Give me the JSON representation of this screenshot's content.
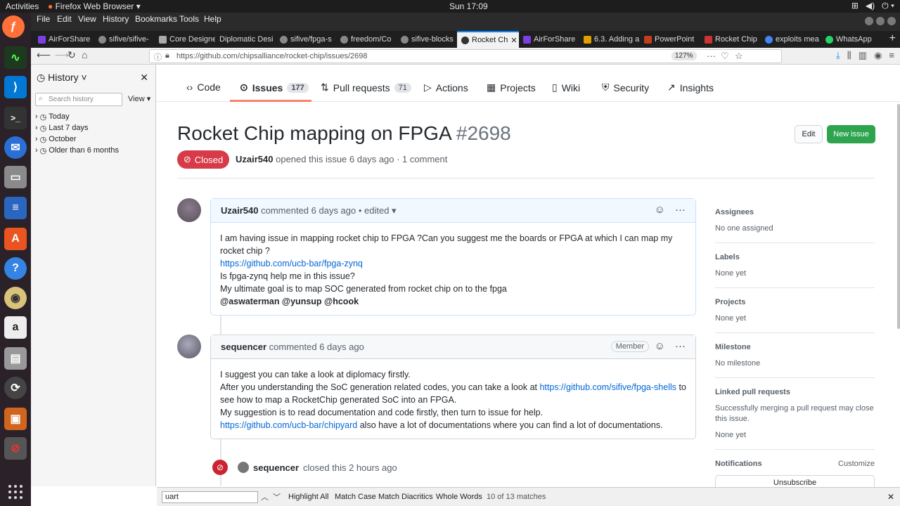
{
  "system": {
    "activities": "Activities",
    "app_menu": "Firefox Web Browser ▾",
    "clock": "Sun 17:09"
  },
  "menubar": [
    "File",
    "Edit",
    "View",
    "History",
    "Bookmarks",
    "Tools",
    "Help"
  ],
  "tabs": [
    {
      "label": "AirForShare",
      "color": "#7b3fe4"
    },
    {
      "label": "sifive/sifive-",
      "color": "#888888"
    },
    {
      "label": "Core Designe",
      "color": "#aaaaaa"
    },
    {
      "label": "Diplomatic Desi",
      "color": "#555555"
    },
    {
      "label": "sifive/fpga-s",
      "color": "#888888"
    },
    {
      "label": "freedom/Co",
      "color": "#888888"
    },
    {
      "label": "sifive-blocks",
      "color": "#888888"
    },
    {
      "label": "Rocket Ch",
      "color": "#333333",
      "active": true
    },
    {
      "label": "AirForShare",
      "color": "#7b3fe4"
    },
    {
      "label": "6.3. Adding a",
      "color": "#e0a000"
    },
    {
      "label": "PowerPoint",
      "color": "#c43e1c"
    },
    {
      "label": "Rocket Chip",
      "color": "#cc3333"
    },
    {
      "label": "exploits mea",
      "color": "#4285f4"
    },
    {
      "label": "WhatsApp",
      "color": "#25d366"
    }
  ],
  "nav": {
    "url": "https://github.com/chipsalliance/rocket-chip/issues/2698",
    "zoom": "127%"
  },
  "history": {
    "title": "History ˅",
    "search_placeholder": "Search history",
    "view": "View",
    "items": [
      "Today",
      "Last 7 days",
      "October",
      "Older than 6 months"
    ]
  },
  "repo_tabs": [
    {
      "label": "Code",
      "icon": "‹›"
    },
    {
      "label": "Issues",
      "count": "177",
      "icon": "⊙"
    },
    {
      "label": "Pull requests",
      "count": "71",
      "icon": "⇅"
    },
    {
      "label": "Actions",
      "icon": "▷"
    },
    {
      "label": "Projects",
      "icon": "▦"
    },
    {
      "label": "Wiki",
      "icon": "▯"
    },
    {
      "label": "Security",
      "icon": "⛨"
    },
    {
      "label": "Insights",
      "icon": "↗"
    }
  ],
  "issue": {
    "title": "Rocket Chip mapping on FPGA",
    "number": "#2698",
    "edit_label": "Edit",
    "new_label": "New issue",
    "status": "Closed",
    "author": "Uzair540",
    "meta": "opened this issue 6 days ago · 1 comment"
  },
  "comments": [
    {
      "author": "Uzair540",
      "meta": "commented 6 days ago • edited ▾",
      "lines": [
        {
          "t": "I am having issue in mapping rocket chip to FPGA ?Can you suggest me the boards or FPGA at which I can map my rocket chip ?"
        },
        {
          "t": "https://github.com/ucb-bar/fpga-zynq",
          "link": true
        },
        {
          "t": "Is fpga-zynq help me in this issue?"
        },
        {
          "t": "My ultimate goal is to map SOC generated from rocket chip on to the fpga"
        },
        {
          "t": "@aswaterman @yunsup @hcook",
          "bold": true
        }
      ]
    },
    {
      "author": "sequencer",
      "meta": "commented 6 days ago",
      "badge": "Member",
      "lines": [
        {
          "t": "I suggest you can take a look at diplomacy firstly."
        },
        {
          "pre": "After you understanding the SoC generation related codes, you can take a look at ",
          "link_text": "https://github.com/sifive/fpga-shells",
          "post": " to see how to map a RocketChip generated SoC into an FPGA."
        },
        {
          "t": "My suggestion is to read documentation and code firstly, then turn to issue for help."
        },
        {
          "pre": "",
          "link_text": "https://github.com/ucb-bar/chipyard",
          "post": " also have a lot of documentations where you can find a lot of documentations."
        }
      ]
    }
  ],
  "closed_event": {
    "actor": "sequencer",
    "text": "closed this 2 hours ago"
  },
  "sidebar": [
    {
      "h": "Assignees",
      "v": "No one assigned"
    },
    {
      "h": "Labels",
      "v": "None yet"
    },
    {
      "h": "Projects",
      "v": "None yet"
    },
    {
      "h": "Milestone",
      "v": "No milestone"
    },
    {
      "h": "Linked pull requests",
      "v": "Successfully merging a pull request may close this issue.",
      "v2": "None yet"
    },
    {
      "h": "Notifications",
      "extra": "Customize",
      "v": "Unsubscribe"
    }
  ],
  "findbar": {
    "value": "uart",
    "highlight": "Highlight All",
    "match_case": "Match Case",
    "diacritics": "Match Diacritics",
    "whole": "Whole Words",
    "result": "10 of 13 matches"
  },
  "colors": {
    "accent": "#0a84ff",
    "closed": "#d73a49",
    "new_issue": "#2ea44f",
    "link": "#0366d6"
  }
}
